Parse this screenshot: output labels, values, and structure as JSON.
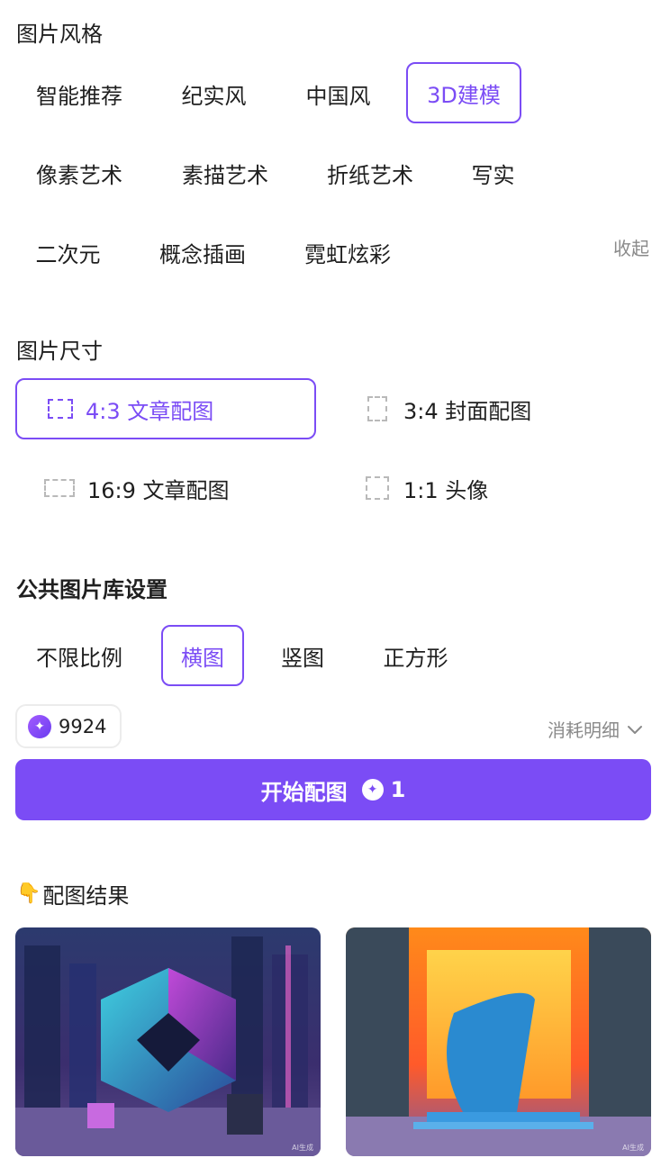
{
  "style_section": {
    "title": "图片风格",
    "chips": [
      "智能推荐",
      "纪实风",
      "中国风",
      "3D建模",
      "像素艺术",
      "素描艺术",
      "折纸艺术",
      "写实",
      "二次元",
      "概念插画",
      "霓虹炫彩"
    ],
    "selected": "3D建模",
    "collapse_label": "收起"
  },
  "size_section": {
    "title": "图片尺寸",
    "options": [
      {
        "label": "4:3 文章配图",
        "selected": true
      },
      {
        "label": "3:4 封面配图",
        "selected": false
      },
      {
        "label": "16:9 文章配图",
        "selected": false
      },
      {
        "label": "1:1 头像",
        "selected": false
      }
    ]
  },
  "library_section": {
    "title": "公共图片库设置",
    "options": [
      "不限比例",
      "横图",
      "竖图",
      "正方形"
    ],
    "selected": "横图"
  },
  "credits": {
    "balance": "9924",
    "detail_label": "消耗明细"
  },
  "start_button": {
    "label": "开始配图",
    "cost": "1"
  },
  "results": {
    "title": "配图结果",
    "images": [
      {
        "name": "3D cube neon city",
        "tag": "AI生成"
      },
      {
        "name": "3D orange room sculpture",
        "tag": "AI生成"
      }
    ]
  },
  "colors": {
    "accent": "#7b4cf5"
  }
}
